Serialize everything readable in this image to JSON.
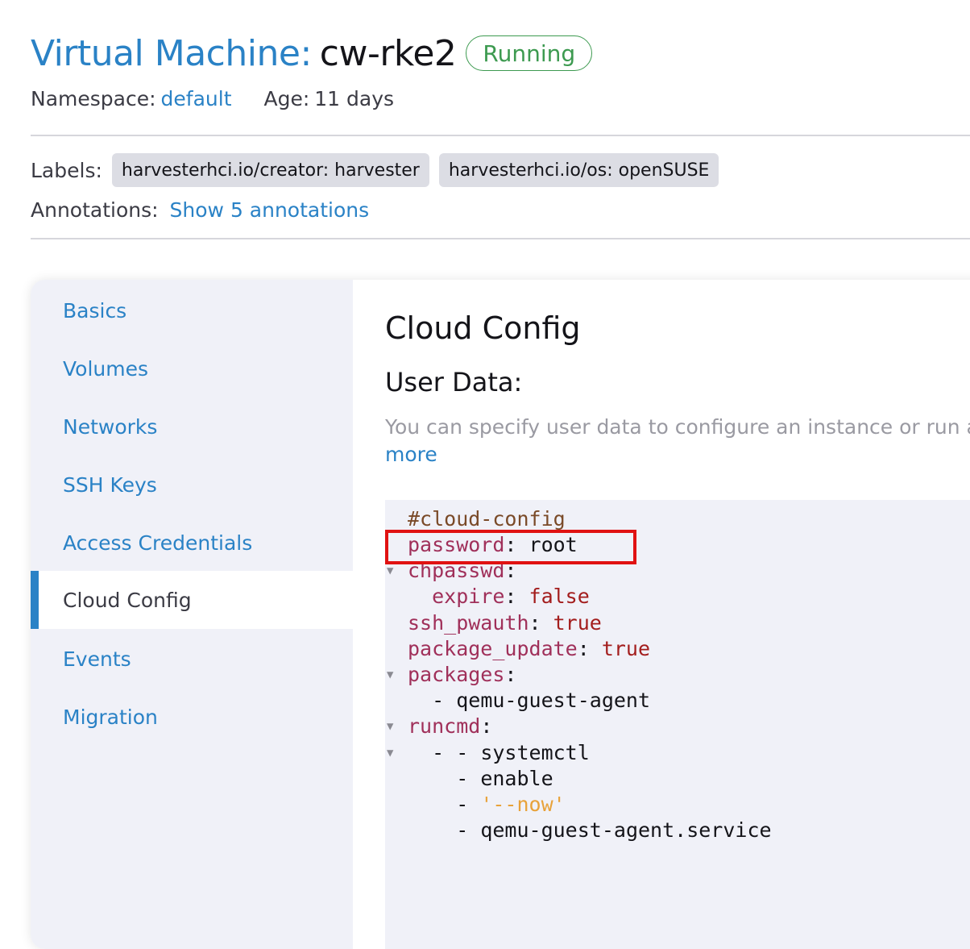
{
  "header": {
    "title_prefix": "Virtual Machine:",
    "title_name": "cw-rke2",
    "status": "Running",
    "namespace_label": "Namespace:",
    "namespace_value": "default",
    "age_label": "Age:",
    "age_value": "11 days"
  },
  "labels": {
    "label": "Labels:",
    "items": [
      "harvesterhci.io/creator: harvester",
      "harvesterhci.io/os: openSUSE"
    ]
  },
  "annotations": {
    "label": "Annotations:",
    "link": "Show 5 annotations"
  },
  "sidebar": {
    "items": [
      {
        "label": "Basics"
      },
      {
        "label": "Volumes"
      },
      {
        "label": "Networks"
      },
      {
        "label": "SSH Keys"
      },
      {
        "label": "Access Credentials"
      },
      {
        "label": "Cloud Config",
        "active": true
      },
      {
        "label": "Events"
      },
      {
        "label": "Migration"
      }
    ]
  },
  "content": {
    "title": "Cloud Config",
    "subtitle": "User Data:",
    "description": "You can specify user data to configure an instance or run a co",
    "more_link": "more"
  },
  "editor": {
    "lines": [
      {
        "key": "#cloud-config"
      },
      {
        "key": "password",
        "sep": ": ",
        "value": "root"
      },
      {
        "key": "chpasswd",
        "sep": ":"
      },
      {
        "indent": "  ",
        "key": "expire",
        "sep": ": ",
        "value": "false"
      },
      {
        "key": "ssh_pwauth",
        "sep": ": ",
        "value": "true"
      },
      {
        "key": "package_update",
        "sep": ": ",
        "value": "true"
      },
      {
        "key": "packages",
        "sep": ":"
      },
      {
        "indent": "  ",
        "dash": "- ",
        "value": "qemu-guest-agent"
      },
      {
        "key": "runcmd",
        "sep": ":"
      },
      {
        "indent": "  ",
        "dash": "- - ",
        "value": "systemctl"
      },
      {
        "indent": "    ",
        "dash": "- ",
        "value": "enable"
      },
      {
        "indent": "    ",
        "dash": "- ",
        "value": "'--now'"
      },
      {
        "indent": "    ",
        "dash": "- ",
        "value": "qemu-guest-agent.service"
      }
    ],
    "fold_icon": "triangle-down-icon"
  },
  "colors": {
    "accent": "#2a82c6",
    "status_green": "#3d9a50",
    "highlight_red": "#e01212",
    "yaml_key": "#a0305a",
    "yaml_bool": "#a31d1d",
    "yaml_string": "#e8a23a"
  }
}
